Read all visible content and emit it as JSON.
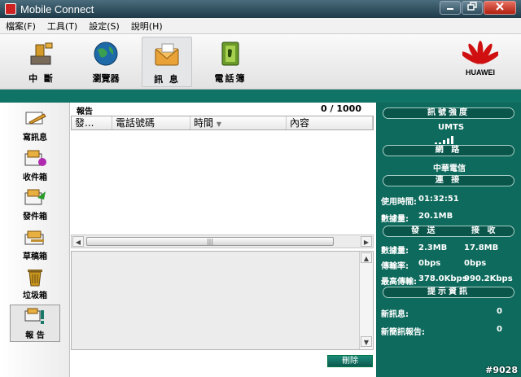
{
  "window": {
    "title": "Mobile Connect"
  },
  "menu": [
    "檔案(F)",
    "工具(T)",
    "設定(S)",
    "說明(H)"
  ],
  "toolbar": {
    "disconnect": "中 斷",
    "browser": "瀏覽器",
    "messages": "訊 息",
    "phonebook": "電話簿",
    "logo_text": "HUAWEI"
  },
  "nav": {
    "compose": "寫訊息",
    "inbox": "收件箱",
    "sent": "發件箱",
    "drafts": "草稿箱",
    "trash": "垃圾箱",
    "reports": "報 告"
  },
  "list": {
    "title": "報告",
    "count": "0 / 1000",
    "columns": {
      "sender": "發...",
      "phone": "電話號碼",
      "time": "時間",
      "content": "內容"
    },
    "delete_label": "刪除"
  },
  "status": {
    "signal_header": "訊號強度",
    "network_type": "UMTS",
    "network_header": "網 路",
    "operator": "中華電信",
    "connection_header": "連 接",
    "usage_label": "使用時間:",
    "usage_time": "01:32:51",
    "data_label": "數據量:",
    "data_total": "20.1MB",
    "send_label": "發 送",
    "recv_label": "接 收",
    "data_sent": "2.3MB",
    "data_recv": "17.8MB",
    "rate_label": "傳輸率:",
    "rate_send": "0bps",
    "rate_recv": "0bps",
    "max_label": "最高傳輸:",
    "max_send": "378.0Kbps",
    "max_recv": "990.2Kbps",
    "info_header": "提示資訊",
    "new_msg_label": "新訊息:",
    "new_msg_count": "0",
    "new_report_label": "新簡訊報告:",
    "new_report_count": "0"
  },
  "watermark": "#9028",
  "colors": {
    "teal": "#0e6a5d",
    "titlebar": "#1e3a48"
  }
}
